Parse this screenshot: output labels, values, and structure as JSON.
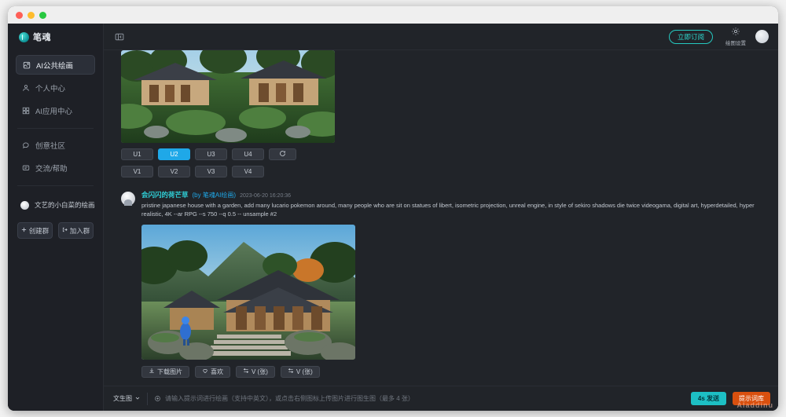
{
  "window": {
    "traffic_lights": [
      "close",
      "minimize",
      "zoom"
    ]
  },
  "sidebar": {
    "brand": {
      "name": "笔魂",
      "logo_icon": "pen-circle-icon"
    },
    "items": [
      {
        "label": "AI公共绘画",
        "icon": "palette-icon",
        "active": true
      },
      {
        "label": "个人中心",
        "icon": "user-icon",
        "active": false
      },
      {
        "label": "AI应用中心",
        "icon": "grid-apps-icon",
        "active": false
      },
      {
        "label": "创意社区",
        "icon": "community-icon",
        "active": false
      },
      {
        "label": "交流/帮助",
        "icon": "help-chat-icon",
        "active": false
      }
    ],
    "group": {
      "name": "文艺的小白菜的绘画群",
      "avatar_icon": "group-avatar-icon"
    },
    "group_buttons": [
      {
        "label": "创建群",
        "icon": "plus-icon"
      },
      {
        "label": "加入群",
        "icon": "enter-icon"
      }
    ]
  },
  "topbar": {
    "collapse_icon": "collapse-sidebar-icon",
    "subscribe_label": "立即订阅",
    "settings_label": "绘图设置",
    "settings_icon": "gear-icon",
    "avatar_icon": "user-avatar-icon"
  },
  "feed": {
    "top_post": {
      "image_alt": "japanese-house-garden-grid",
      "upscale_buttons": [
        {
          "label": "U1",
          "selected": false
        },
        {
          "label": "U2",
          "selected": true
        },
        {
          "label": "U3",
          "selected": false
        },
        {
          "label": "U4",
          "selected": false
        }
      ],
      "reroll_icon": "refresh-icon",
      "variation_buttons": [
        {
          "label": "V1"
        },
        {
          "label": "V2"
        },
        {
          "label": "V3"
        },
        {
          "label": "V4"
        }
      ]
    },
    "post": {
      "username": "会闪闪的荷芒草",
      "by_label": "(by 笔魂AI绘画)",
      "timestamp": "2023-06-20 16:20:36",
      "prompt": "pristine japanese house with a garden, add many lucario pokemon around, many people who are sit on statues of libert, isometric projection, unreal engine, in style of sekiro shadows die twice videogama, digital art, hyperdetailed, hyper realistic, 4K --ar RPG --s 750 --q 0.5 -- unsample #2",
      "image_alt": "japanese-house-garden-upscaled",
      "actions": [
        {
          "label": "下载图片",
          "icon": "download-icon"
        },
        {
          "label": "喜欢",
          "icon": "heart-icon"
        },
        {
          "label": "V (张)",
          "icon": "variation-icon"
        },
        {
          "label": "V (张)",
          "icon": "variation-icon"
        }
      ]
    }
  },
  "composer": {
    "mode_label": "文生图",
    "mode_chevron_icon": "chevron-down-icon",
    "prefix_icon": "sparkle-icon",
    "placeholder": "请输入提示词进行绘画（支持中英文），或点击右侧图标上传图片进行图生图（最多 4 张）",
    "value": "",
    "send_label": "4s 发送",
    "library_label": "提示词库"
  },
  "watermark": "Aladdinu"
}
